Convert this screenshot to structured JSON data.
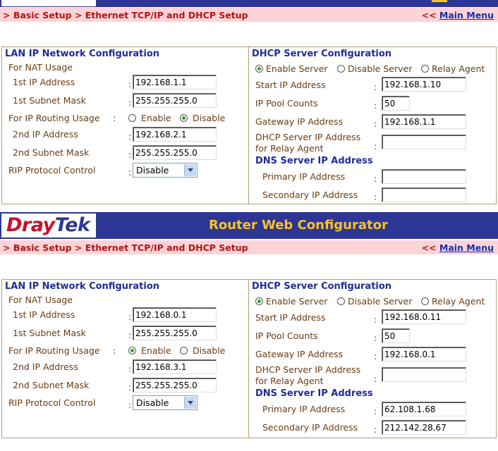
{
  "app": {
    "logo_dray": "Dray",
    "logo_tek": "Tek",
    "title": "Router Web Configurator"
  },
  "breadcrumb": "> Basic Setup > Ethernet TCP/IP and DHCP Setup",
  "main_menu_prefix": "<<",
  "main_menu_label": "Main Menu",
  "panels": [
    {
      "lan": {
        "title": "LAN IP Network Configuration",
        "nat_label": "For NAT Usage",
        "ip1_label": "1st IP Address",
        "ip1": "192.168.1.1",
        "mask1_label": "1st Subnet Mask",
        "mask1": "255.255.255.0",
        "routing_label": "For IP Routing Usage",
        "routing_colon": ":",
        "enable": "Enable",
        "disable": "Disable",
        "routing_selected": "Disable",
        "ip2_label": "2nd IP Address",
        "ip2": "192.168.2.1",
        "mask2_label": "2nd Subnet Mask",
        "mask2": "255.255.255.0",
        "rip_label": "RIP Protocol Control",
        "rip": "Disable"
      },
      "dhcp": {
        "title": "DHCP Server Configuration",
        "enable_server": "Enable Server",
        "disable_server": "Disable Server",
        "relay_agent": "Relay Agent",
        "mode_selected": "Enable Server",
        "start_label": "Start IP Address",
        "start": "192.168.1.10",
        "pool_label": "IP Pool Counts",
        "pool": "50",
        "gateway_label": "Gateway IP Address",
        "gateway": "192.168.1.1",
        "relay_label_1": "DHCP Server IP Address",
        "relay_label_2": "for Relay Agent",
        "relay": "",
        "dns_title": "DNS Server IP Address",
        "primary_label": "Primary IP Address",
        "primary": "",
        "secondary_label": "Secondary IP Address",
        "secondary": ""
      }
    },
    {
      "lan": {
        "title": "LAN IP Network Configuration",
        "nat_label": "For NAT Usage",
        "ip1_label": "1st IP Address",
        "ip1": "192.168.0.1",
        "mask1_label": "1st Subnet Mask",
        "mask1": "255.255.255.0",
        "routing_label": "For IP Routing Usage",
        "routing_colon": ":",
        "enable": "Enable",
        "disable": "Disable",
        "routing_selected": "Enable",
        "ip2_label": "2nd IP Address",
        "ip2": "192.168.3.1",
        "mask2_label": "2nd Subnet Mask",
        "mask2": "255.255.255.0",
        "rip_label": "RIP Protocol Control",
        "rip": "Disable"
      },
      "dhcp": {
        "title": "DHCP Server Configuration",
        "enable_server": "Enable Server",
        "disable_server": "Disable Server",
        "relay_agent": "Relay Agent",
        "mode_selected": "Enable Server",
        "start_label": "Start IP Address",
        "start": "192.168.0.11",
        "pool_label": "IP Pool Counts",
        "pool": "50",
        "gateway_label": "Gateway IP Address",
        "gateway": "192.168.0.1",
        "relay_label_1": "DHCP Server IP Address",
        "relay_label_2": "for Relay Agent",
        "relay": "",
        "dns_title": "DNS Server IP Address",
        "primary_label": "Primary IP Address",
        "primary": "62.108.1.68",
        "secondary_label": "Secondary IP Address",
        "secondary": "212.142.28.67"
      }
    }
  ]
}
